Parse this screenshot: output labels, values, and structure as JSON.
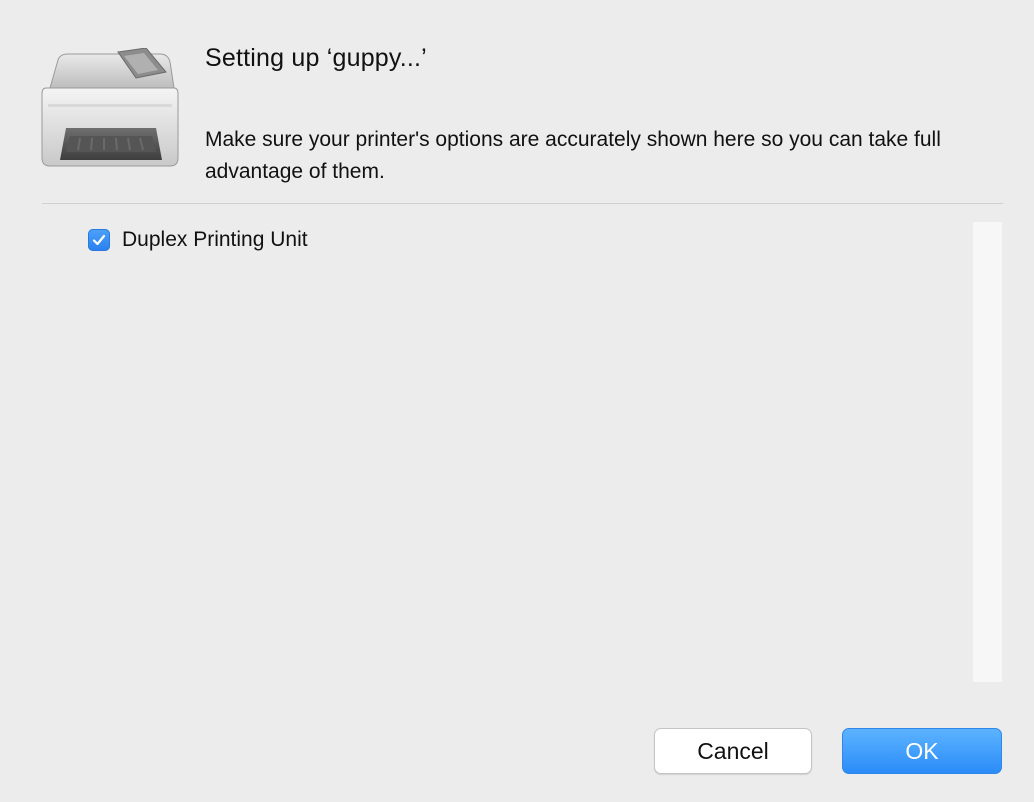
{
  "dialog": {
    "title": "Setting up ‘guppy...’",
    "message": "Make sure your printer's options are accurately shown here so you can take full advantage of them.",
    "icon": "printer-icon"
  },
  "options": [
    {
      "label": "Duplex Printing Unit",
      "checked": true
    }
  ],
  "buttons": {
    "cancel_label": "Cancel",
    "ok_label": "OK"
  },
  "colors": {
    "accent": "#2a7ff0",
    "background": "#ececec"
  }
}
